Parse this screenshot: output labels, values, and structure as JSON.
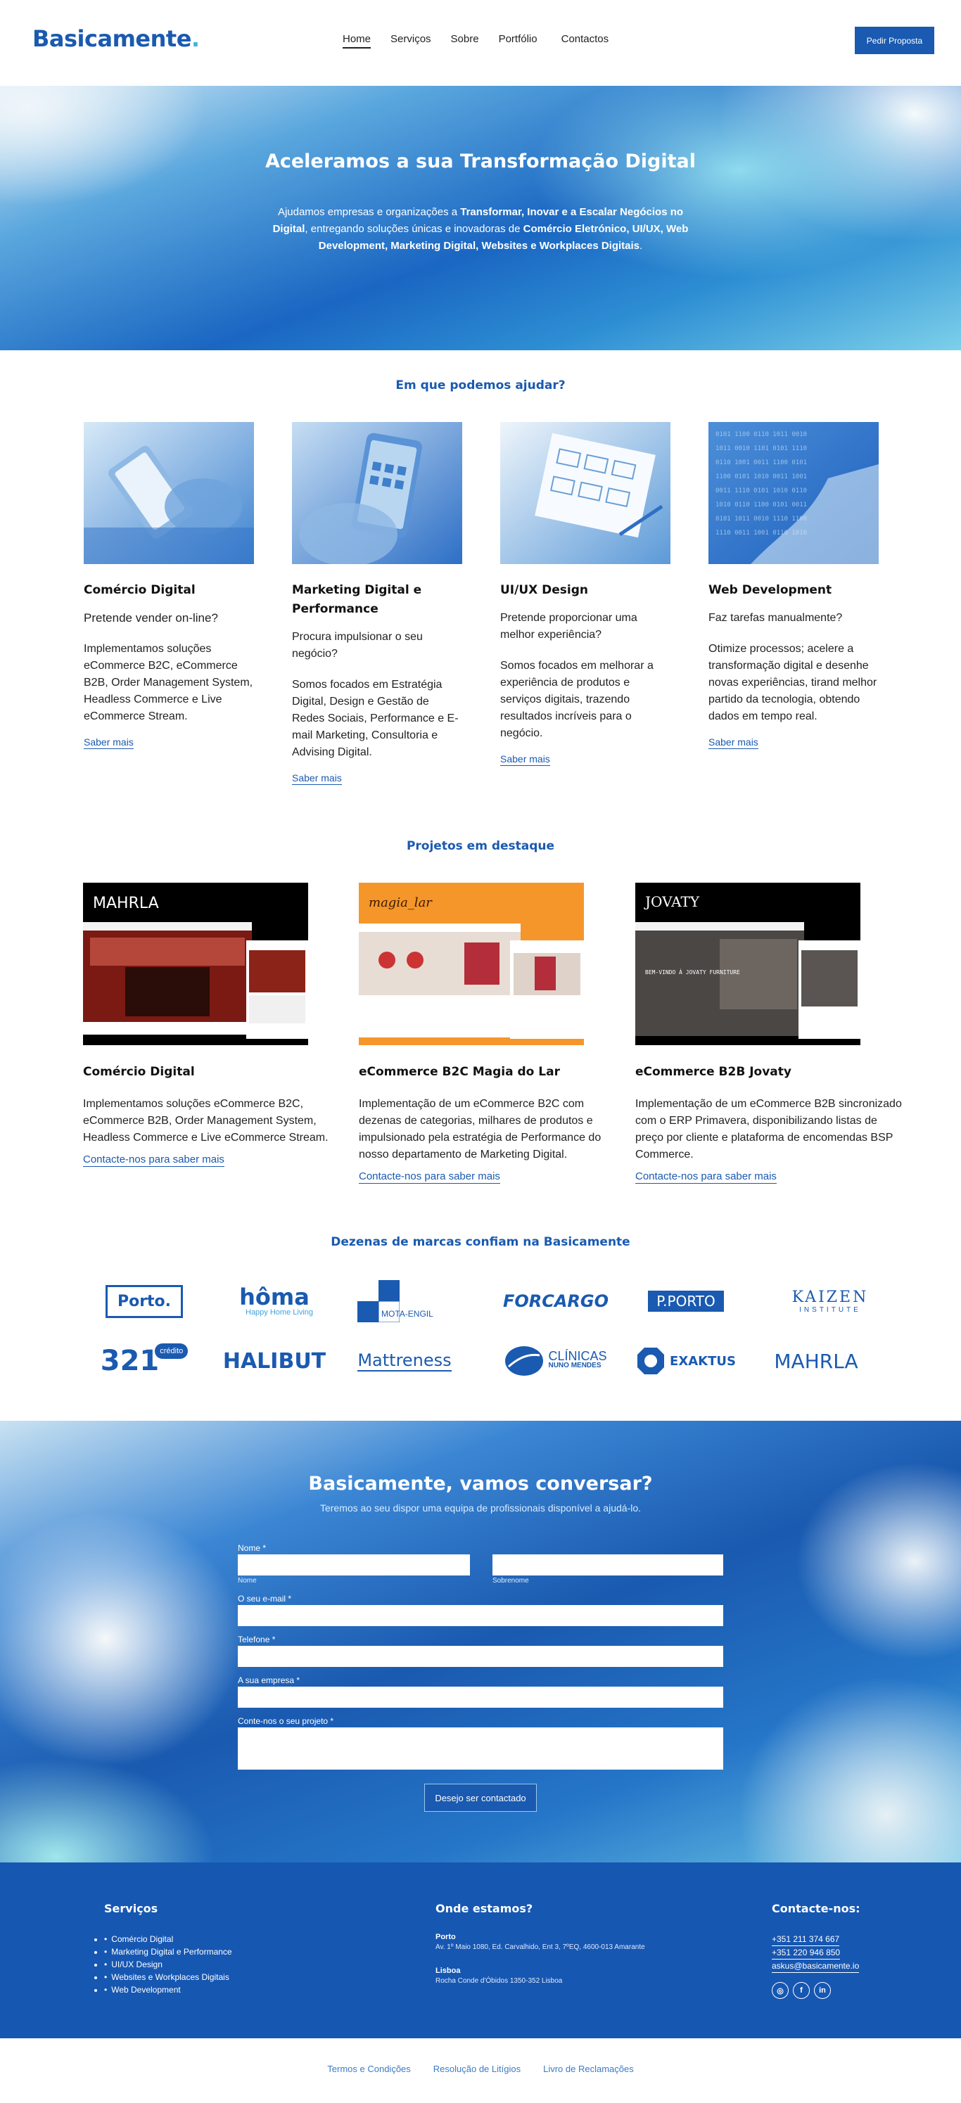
{
  "header": {
    "logo": "Basicamente",
    "logo_dot": ".",
    "nav": [
      "Home",
      "Serviços",
      "Sobre",
      "Portfólio",
      "Contactos"
    ],
    "cta": "Pedir Proposta"
  },
  "hero": {
    "title": "Aceleramos a sua Transformação Digital",
    "p1": "Ajudamos empresas e organizações a ",
    "b1": "Transformar, Inovar e a Escalar Negócios no Digital",
    "p2": ", entregando soluções únicas e inovadoras de ",
    "b2": "Comércio Eletrónico, UI/UX, Web Development, Marketing Digital, Websites e Workplaces Digitais",
    "p3": "."
  },
  "services": {
    "title": "Em que podemos ajudar?",
    "items": [
      {
        "title": "Comércio Digital",
        "question": "Pretende vender on-line?",
        "body": "Implementamos soluções eCommerce B2C, eCommerce B2B, Order Management System, Headless Commerce e Live eCommerce Stream.",
        "link": "Saber mais"
      },
      {
        "title": "Marketing Digital e Performance",
        "question": "Procura impulsionar o seu negócio?",
        "body": "Somos focados em Estratégia Digital, Design e Gestão de Redes Sociais, Performance e E-mail Marketing, Consultoria e Advising Digital.",
        "link": "Saber mais"
      },
      {
        "title": "UI/UX Design",
        "question": "Pretende proporcionar uma melhor experiência?",
        "body": "Somos focados em melhorar a experiência de produtos e serviços digitais, trazendo resultados incríveis para o negócio.",
        "link": "Saber mais"
      },
      {
        "title": "Web Development",
        "question": "Faz tarefas manualmente?",
        "body": "Otimize processos; acelere a transformação digital e desenhe novas experiências, tirand melhor partido da tecnologia, obtendo dados em tempo real.",
        "link": "Saber mais"
      }
    ]
  },
  "projects": {
    "title": "Projetos em destaque",
    "items": [
      {
        "title": "Comércio Digital",
        "body": "Implementamos soluções eCommerce B2C, eCommerce B2B, Order Management System, Headless Commerce e Live eCommerce Stream.",
        "link": "Contacte-nos para saber mais",
        "brand": "MAHRLA"
      },
      {
        "title": "eCommerce B2C Magia do Lar",
        "body": "Implementação de um eCommerce B2C com dezenas de categorias, milhares de produtos e impulsionado pela estratégia de Performance do nosso departamento de Marketing Digital.",
        "link": "Contacte-nos para saber mais",
        "brand": "magia_lar"
      },
      {
        "title": "eCommerce B2B Jovaty",
        "body": "Implementação de um eCommerce B2B sincronizado com o ERP Primavera, disponibilizando listas de preço por cliente e plataforma de encomendas BSP Commerce.",
        "link": "Contacte-nos para saber mais",
        "brand": "JOVATY",
        "hero_text": "BEM-VINDO À JOVATY FURNITURE"
      }
    ]
  },
  "brands": {
    "title": "Dezenas de marcas confiam na Basicamente",
    "porto": "Porto.",
    "homa": "hôma",
    "homa_tag": "Happy Home Living",
    "mota": "MOTA-ENGIL",
    "forcargo": "FORCARGO",
    "pporto": "P.PORTO",
    "kaizen": "KAIZEN",
    "kaizen_sub": "INSTITUTE",
    "c321": "321",
    "c321_badge": "crédito",
    "halibut": "HALIBUT",
    "mattreness": "Mattreness",
    "clinicas": "CLÍNICAS",
    "clinicas_sub": "NUNO MENDES",
    "exaktus": "EXAKTUS",
    "mahrla": "MAHRLA"
  },
  "contact": {
    "title": "Basicamente, vamos conversar?",
    "subtitle": "Teremos ao seu dispor uma equipa de profissionais disponível a ajudá-lo.",
    "name_label": "Nome *",
    "first_hint": "Nome",
    "last_hint": "Sobrenome",
    "email_label": "O seu e-mail *",
    "phone_label": "Telefone *",
    "company_label": "A sua empresa *",
    "project_label": "Conte-nos o seu projeto *",
    "submit": "Desejo ser contactado"
  },
  "footer": {
    "services_title": "Serviços",
    "services": [
      "Comércio Digital",
      "Marketing Digital e Performance",
      "UI/UX Design",
      "Websites e Workplaces Digitais",
      "Web Development"
    ],
    "where_title": "Onde estamos?",
    "porto_title": "Porto",
    "porto_addr": "Av. 1º Maio 1080, Ed. Carvalhido, Ent 3, 7ºEQ, 4600-013 Amarante",
    "lisboa_title": "Lisboa",
    "lisboa_addr": "Rocha Conde d'Óbidos 1350-352 Lisboa",
    "contact_title": "Contacte-nos:",
    "phone1": "+351 211 374 667",
    "phone2": "+351 220 946 850",
    "email": "askus@basicamente.io"
  },
  "bottom": [
    "Termos e Condições",
    "Resolução de Litígios",
    "Livro de Reclamações"
  ]
}
